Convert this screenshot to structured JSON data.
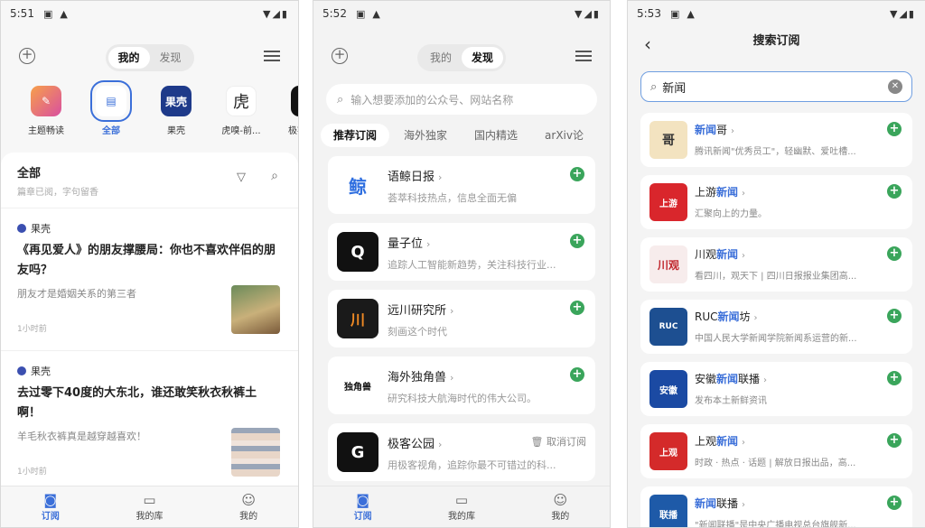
{
  "panel1": {
    "status_time": "5:51",
    "seg": [
      "我的",
      "发现"
    ],
    "sources": [
      {
        "label": "主题畅读",
        "logo": "✎",
        "color": "#e05a8a"
      },
      {
        "label": "全部",
        "logo": "▤",
        "color": "#3b6fd9"
      },
      {
        "label": "果壳",
        "logo": "果壳",
        "color": "#1e3a8a"
      },
      {
        "label": "虎嗅-前...",
        "logo": "虎",
        "color": "#ffffff"
      },
      {
        "label": "极客公园",
        "logo": "G",
        "color": "#111111"
      }
    ],
    "section_title": "全部",
    "section_sub": "篇章已阅，字句留香",
    "articles": [
      {
        "source": "果壳",
        "title": "《再见爱人》的朋友撑腰局：你也不喜欢伴侣的朋友吗？",
        "sub": "朋友才是婚姻关系的第三者",
        "time": "1小时前"
      },
      {
        "source": "果壳",
        "title": "去过零下40度的大东北，谁还敢笑秋衣秋裤土啊！",
        "sub": "羊毛秋衣裤真是越穿越喜欢！",
        "time": "1小时前"
      }
    ],
    "tabs": [
      "订阅",
      "我的库",
      "我的"
    ]
  },
  "panel2": {
    "status_time": "5:52",
    "seg": [
      "我的",
      "发现"
    ],
    "search_placeholder": "输入想要添加的公众号、网站名称",
    "categories": [
      "推荐订阅",
      "海外独家",
      "国内精选",
      "arXiv论"
    ],
    "feeds": [
      {
        "name": "语鲸日报",
        "desc": "荟萃科技热点，信息全面无偏",
        "logo": "鲸",
        "color": "#ffffff",
        "action": "add"
      },
      {
        "name": "量子位",
        "desc": "追踪人工智能新趋势，关注科技行业...",
        "logo": "Q",
        "color": "#111111",
        "action": "add"
      },
      {
        "name": "远川研究所",
        "desc": "刻画这个时代",
        "logo": "川",
        "color": "#1a1a1a",
        "action": "add"
      },
      {
        "name": "海外独角兽",
        "desc": "研究科技大航海时代的伟大公司。",
        "logo": "独角兽",
        "color": "#ffffff",
        "action": "add"
      },
      {
        "name": "极客公园",
        "desc": "用极客视角，追踪你最不可错过的科...",
        "logo": "G",
        "color": "#111111",
        "action": "unsubscribe",
        "action_label": "取消订阅"
      }
    ],
    "tabs": [
      "订阅",
      "我的库",
      "我的"
    ]
  },
  "panel3": {
    "status_time": "5:53",
    "title": "搜索订阅",
    "query": "新闻",
    "results": [
      {
        "pre": "",
        "hl": "新闻",
        "post": "哥",
        "desc": "腾讯新闻\"优秀员工\"，轻幽默、爱吐槽...",
        "logo": "哥",
        "color": "#f3e3c0"
      },
      {
        "pre": "上游",
        "hl": "新闻",
        "post": "",
        "desc": "汇聚向上的力量。",
        "logo": "上游",
        "color": "#d9262c"
      },
      {
        "pre": "川观",
        "hl": "新闻",
        "post": "",
        "desc": "看四川，观天下 | 四川日报报业集团高...",
        "logo": "川观",
        "color": "#f7ecec"
      },
      {
        "pre": "RUC",
        "hl": "新闻",
        "post": "坊",
        "desc": "中国人民大学新闻学院新闻系运营的新...",
        "logo": "RUC",
        "color": "#1d4f91"
      },
      {
        "pre": "安徽",
        "hl": "新闻",
        "post": "联播",
        "desc": "发布本土新鲜资讯",
        "logo": "安徽",
        "color": "#1b4aa3"
      },
      {
        "pre": "上观",
        "hl": "新闻",
        "post": "",
        "desc": "时政 · 热点 · 话题 | 解放日报出品，高...",
        "logo": "上观",
        "color": "#d42a2a"
      },
      {
        "pre": "",
        "hl": "新闻",
        "post": "联播",
        "desc": "\"新闻联播\"是中央广播电视总台旗舰新...",
        "logo": "联播",
        "color": "#1e5aa8"
      }
    ]
  }
}
